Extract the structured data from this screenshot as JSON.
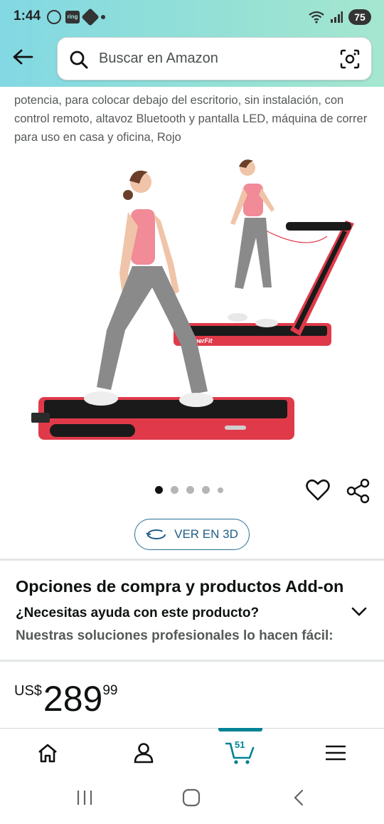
{
  "status_bar": {
    "time": "1:44",
    "battery": "75",
    "ring_label": "ring"
  },
  "search": {
    "placeholder": "Buscar en Amazon"
  },
  "product": {
    "description": "potencia, para colocar debajo del escritorio, sin instalación, con control remoto, altavoz Bluetooth y pantalla LED, máquina de correr para uso en casa y oficina, Rojo",
    "brand_mark": "SuperFit",
    "image_count": 5,
    "active_image": 1,
    "view_3d_label": "VER EN 3D"
  },
  "options": {
    "title": "Opciones de compra y productos Add-on",
    "help_question": "¿Necesitas ayuda con este producto?",
    "help_subtitle": "Nuestras soluciones profesionales lo hacen fácil:"
  },
  "price": {
    "currency": "US$",
    "whole": "289",
    "fraction": "99"
  },
  "bottom_nav": {
    "cart_count": "51",
    "active": "cart"
  },
  "colors": {
    "header_gradient_start": "#82d8e3",
    "header_gradient_end": "#a5e6cf",
    "accent_teal": "#008296",
    "link_blue": "#1f5d87",
    "treadmill_red": "#e03a4a"
  }
}
